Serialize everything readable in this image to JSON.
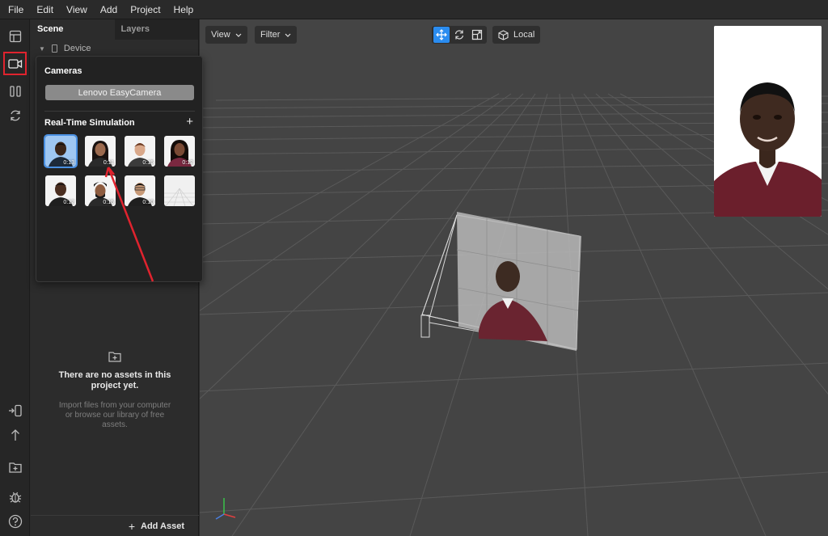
{
  "menu": [
    "File",
    "Edit",
    "View",
    "Add",
    "Project",
    "Help"
  ],
  "panel": {
    "tabs": [
      "Scene",
      "Layers"
    ],
    "device_label": "Device",
    "empty_title": "There are no assets in this project yet.",
    "empty_desc": "Import files from your computer or browse our library of free assets.",
    "add_asset": "Add Asset"
  },
  "viewport": {
    "view_label": "View",
    "filter_label": "Filter",
    "space_label": "Local"
  },
  "popover": {
    "cameras_title": "Cameras",
    "camera_name": "Lenovo EasyCamera",
    "rts_title": "Real-Time Simulation",
    "rts_plus": "+",
    "thumbs": [
      {
        "duration": "0:13",
        "selected": true
      },
      {
        "duration": "0:11"
      },
      {
        "duration": "0:15"
      },
      {
        "duration": "0:12"
      },
      {
        "duration": "0:12"
      },
      {
        "duration": "0:15"
      },
      {
        "duration": "0:10"
      },
      {
        "duration": ""
      }
    ]
  },
  "colors": {
    "accent": "#2a8cf0",
    "highlight_box": "#e0232e",
    "annotation_arrow": "#e0232e"
  },
  "icons": {
    "rail": [
      "layout-icon",
      "camera-icon",
      "pause-icon",
      "refresh-icon",
      "device-import-icon",
      "upload-icon",
      "add-folder-icon",
      "bug-icon",
      "help-icon"
    ],
    "gizmo": [
      "move-icon",
      "rotate-icon",
      "scale-icon",
      "cube-icon"
    ]
  }
}
